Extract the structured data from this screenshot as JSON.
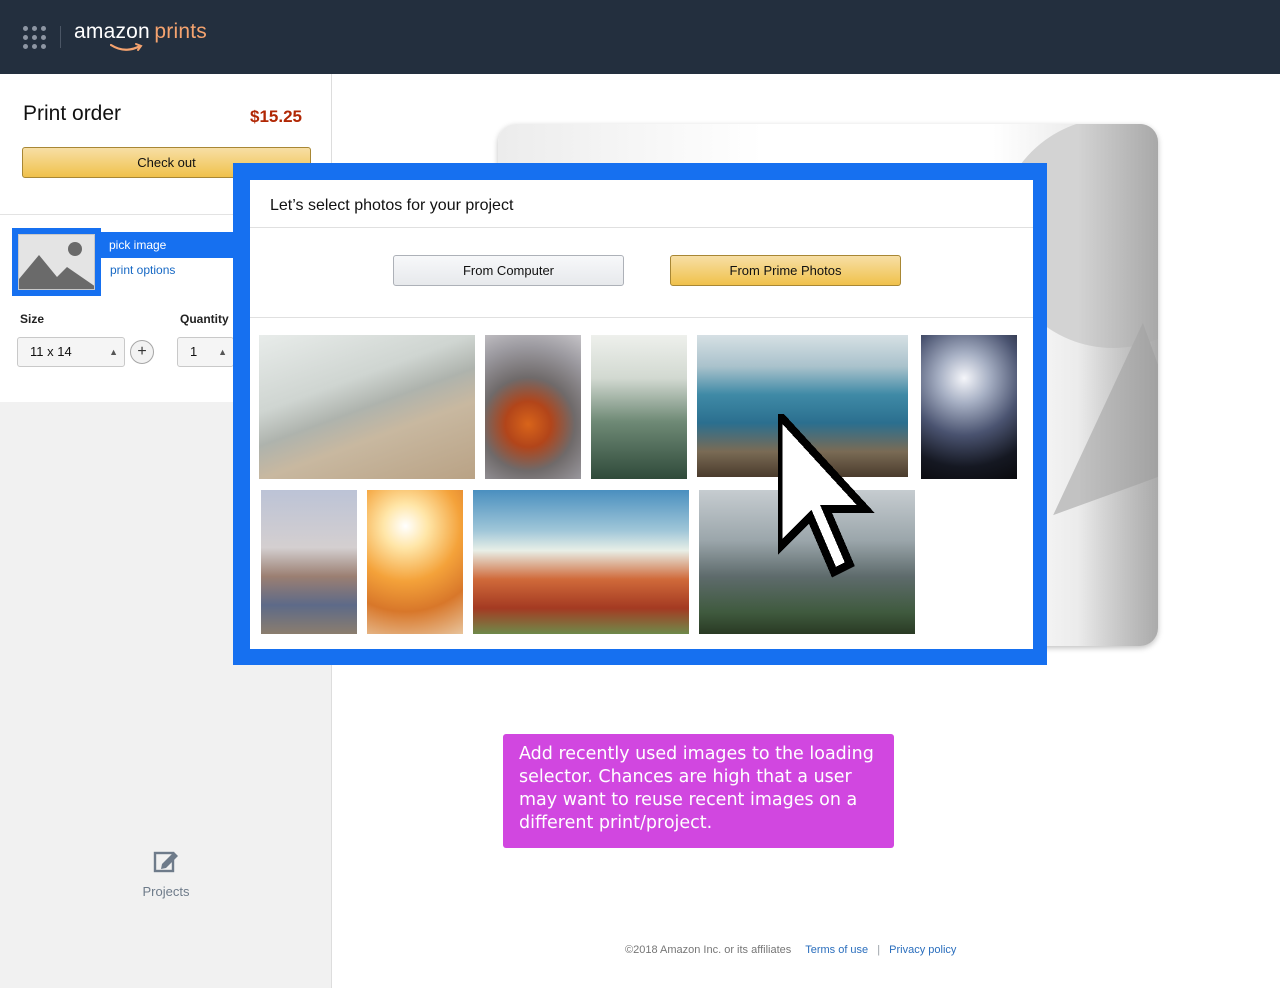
{
  "header": {
    "logo_word1": "amazon",
    "logo_word2": "prints",
    "apps_icon": "apps-grid-icon"
  },
  "order": {
    "title": "Print order",
    "price": "$15.25",
    "checkout_label": "Check out"
  },
  "item": {
    "pick_image_label": "pick image",
    "print_options_label": "print options",
    "size_label": "Size",
    "size_value": "11 x 14",
    "quantity_label": "Quantity",
    "quantity_value": "1",
    "add_icon": "plus-icon"
  },
  "sidebar": {
    "projects_label": "Projects",
    "projects_icon": "edit-icon"
  },
  "modal": {
    "title": "Let’s select photos for your project",
    "from_computer_label": "From Computer",
    "from_prime_label": "From Prime Photos",
    "photos": [
      {
        "subject": "beach shoreline"
      },
      {
        "subject": "orange marigold flower"
      },
      {
        "subject": "misty pine forest"
      },
      {
        "subject": "rocky sea coast"
      },
      {
        "subject": "concert stage lights"
      },
      {
        "subject": "woman overlooking canyon"
      },
      {
        "subject": "woman in sunlight"
      },
      {
        "subject": "red rock desert"
      },
      {
        "subject": "hiker on mountain"
      }
    ]
  },
  "annotation": {
    "text": "Add recently used images to the loading selector. Chances are high that a user may want to reuse recent images on a different print/project."
  },
  "footer": {
    "copyright": "©2018 Amazon Inc. or its affiliates",
    "terms_label": "Terms of use",
    "separator": "|",
    "privacy_label": "Privacy policy"
  },
  "colors": {
    "header_bg": "#232f3e",
    "selection_blue": "#1670f0",
    "price_red": "#b12704",
    "button_yellow": "#f0c14b",
    "annotation_purple": "#d147e0",
    "link_blue": "#2a6ebd"
  }
}
